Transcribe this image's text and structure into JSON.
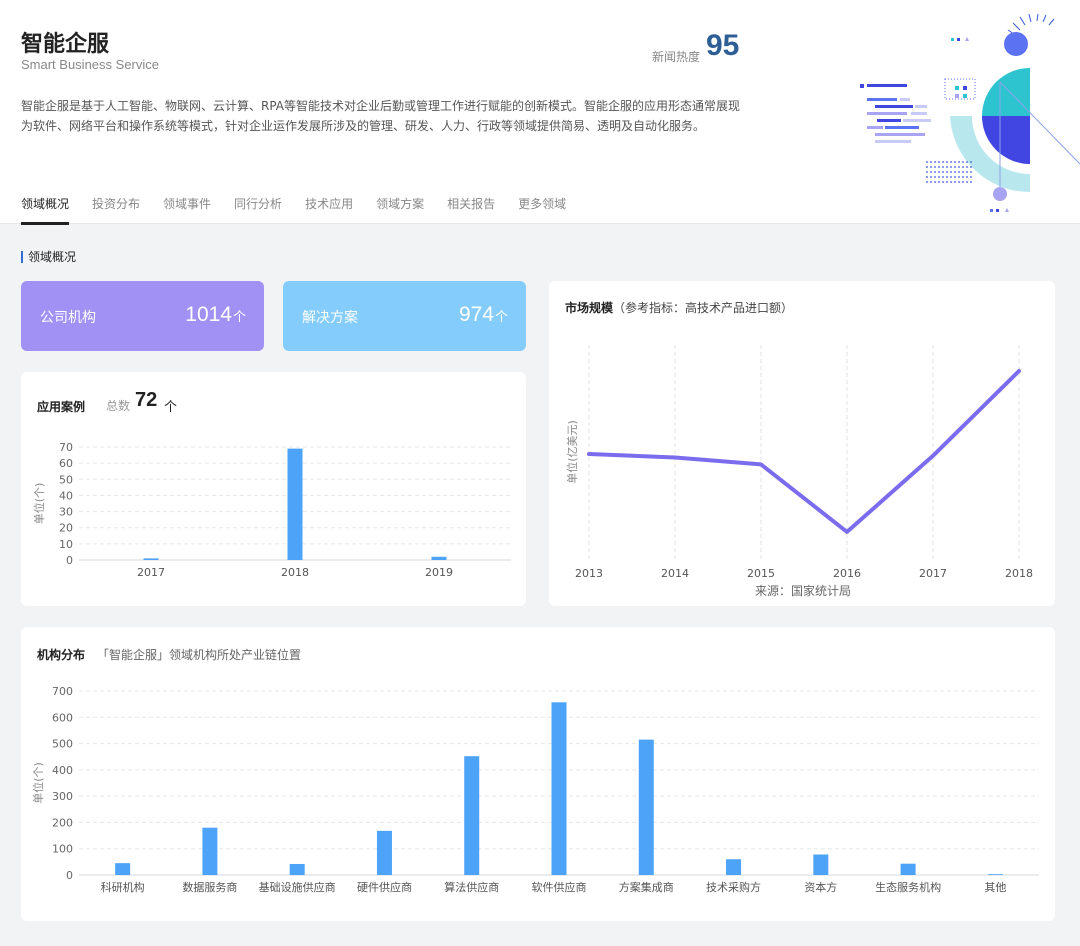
{
  "header": {
    "title": "智能企服",
    "subtitle": "Smart Business Service",
    "heat_label": "新闻热度",
    "heat_value": "95",
    "description": "智能企服是基于人工智能、物联网、云计算、RPA等智能技术对企业后勤或管理工作进行赋能的创新模式。智能企服的应用形态通常展现为软件、网络平台和操作系统等模式，针对企业运作发展所涉及的管理、研发、人力、行政等领域提供简易、透明及自动化服务。"
  },
  "tabs": [
    {
      "label": "领域概况",
      "active": true
    },
    {
      "label": "投资分布",
      "active": false
    },
    {
      "label": "领域事件",
      "active": false
    },
    {
      "label": "同行分析",
      "active": false
    },
    {
      "label": "技术应用",
      "active": false
    },
    {
      "label": "领域方案",
      "active": false
    },
    {
      "label": "相关报告",
      "active": false
    },
    {
      "label": "更多领域",
      "active": false
    }
  ],
  "section_label": "领域概况",
  "stats": {
    "company": {
      "label": "公司机构",
      "value": "1014",
      "unit": "个",
      "color": "#a191f5"
    },
    "solution": {
      "label": "解决方案",
      "value": "974",
      "unit": "个",
      "color": "#84ccfb"
    }
  },
  "cases": {
    "title": "应用案例",
    "total_label": "总数",
    "total_value": "72",
    "total_unit": "个"
  },
  "market": {
    "title": "市场规模",
    "subtitle": "（参考指标：高技术产品进口额）",
    "source": "来源：国家统计局"
  },
  "org": {
    "title": "机构分布",
    "subtitle": "「智能企服」领域机构所处产业链位置"
  },
  "chart_data": [
    {
      "id": "cases",
      "type": "bar",
      "categories": [
        "2017",
        "2018",
        "2019"
      ],
      "values": [
        1,
        69,
        2
      ],
      "ylabel": "单位(个)",
      "ylim": [
        0,
        70
      ],
      "yticks": [
        0,
        10,
        20,
        30,
        40,
        50,
        60,
        70
      ],
      "color": "#4da3f7",
      "grid": true
    },
    {
      "id": "market",
      "type": "line",
      "categories": [
        "2013",
        "2014",
        "2015",
        "2016",
        "2017",
        "2018"
      ],
      "values": [
        0.52,
        0.5,
        0.46,
        0.07,
        0.51,
        1.0
      ],
      "ylabel": "单位(亿美元)",
      "color": "#7b6cee",
      "grid": true
    },
    {
      "id": "org",
      "type": "bar",
      "categories": [
        "科研机构",
        "数据服务商",
        "基础设施供应商",
        "硬件供应商",
        "算法供应商",
        "软件供应商",
        "方案集成商",
        "技术采购方",
        "资本方",
        "生态服务机构",
        "其他"
      ],
      "values": [
        45,
        180,
        42,
        168,
        452,
        657,
        515,
        60,
        78,
        43,
        3
      ],
      "ylabel": "单位(个)",
      "ylim": [
        0,
        700
      ],
      "yticks": [
        0,
        100,
        200,
        300,
        400,
        500,
        600,
        700
      ],
      "color": "#4da3f7",
      "grid": true
    }
  ]
}
